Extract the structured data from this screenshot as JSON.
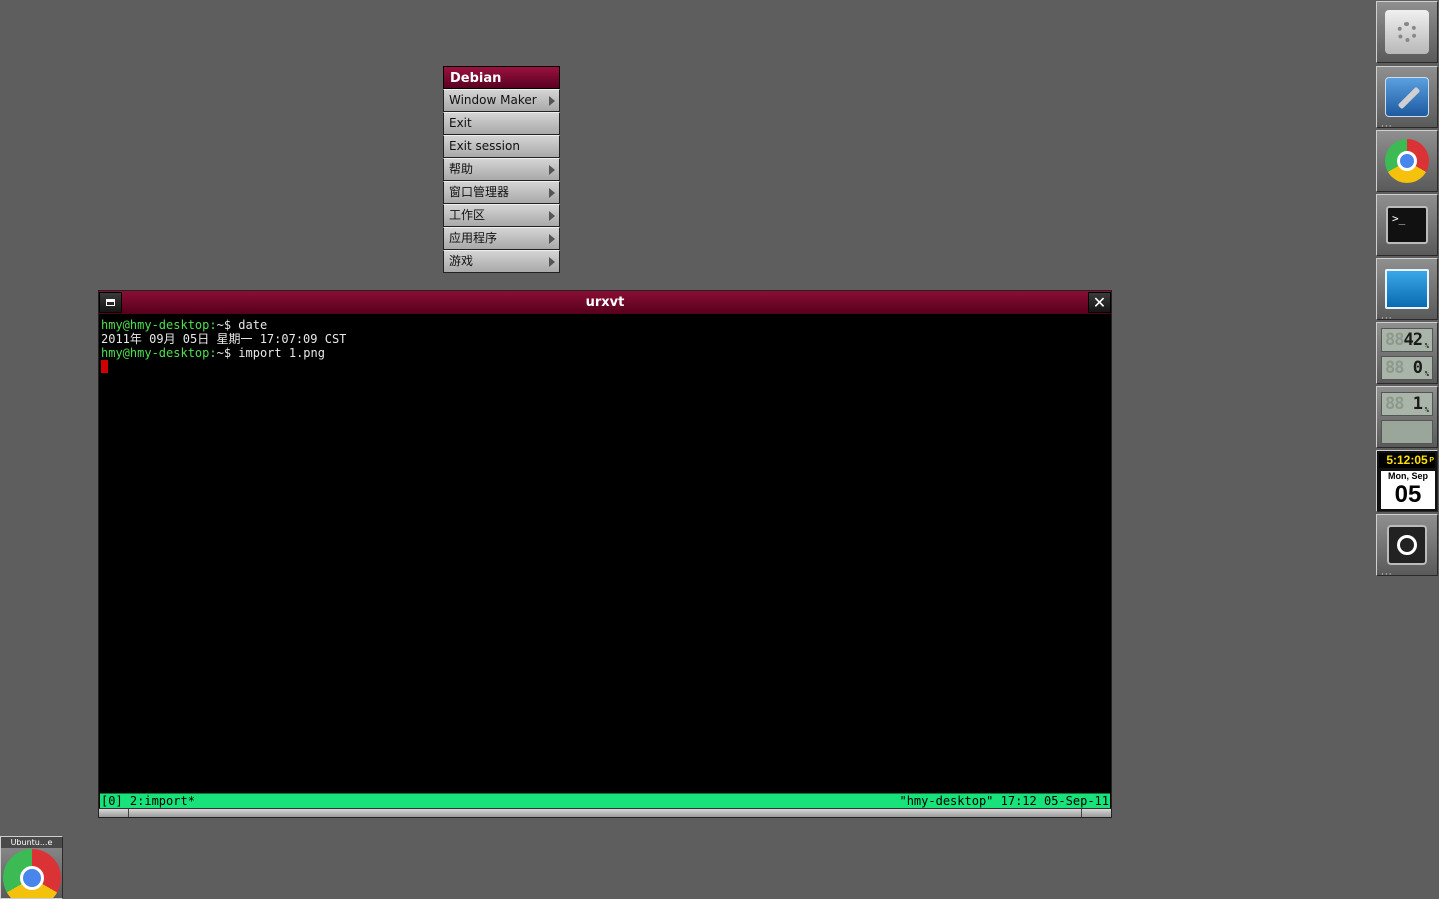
{
  "root_menu": {
    "title": "Debian",
    "items": [
      {
        "label": "Window Maker",
        "submenu": true
      },
      {
        "label": "Exit",
        "submenu": false
      },
      {
        "label": "Exit session",
        "submenu": false
      },
      {
        "label": "帮助",
        "submenu": true
      },
      {
        "label": "窗口管理器",
        "submenu": true
      },
      {
        "label": "工作区",
        "submenu": true
      },
      {
        "label": "应用程序",
        "submenu": true
      },
      {
        "label": "游戏",
        "submenu": true
      }
    ]
  },
  "terminal": {
    "title": "urxvt",
    "lines": [
      {
        "prompt": "hmy@hmy-desktop:",
        "text": "~$ date"
      },
      {
        "prompt": "",
        "text": "2011年 09月 05日 星期一 17:07:09 CST"
      },
      {
        "prompt": "hmy@hmy-desktop:",
        "text": "~$ import 1.png"
      }
    ],
    "status_left": "[0] 2:import*",
    "status_right": "\"hmy-desktop\" 17:12 05-Sep-11"
  },
  "dock": {
    "icons": [
      "gear-icon",
      "tools-icon",
      "chrome-icon",
      "terminal-icon",
      "system-monitor-icon",
      "memory-monitor",
      "cpu-monitor",
      "clock",
      "power-icon"
    ],
    "memory": {
      "mem_value": "42",
      "swap_value": "0",
      "unit": "%"
    },
    "cpu": {
      "value": "1",
      "unit": "%"
    },
    "clock": {
      "time": "5:12:05",
      "ampm": "P",
      "daymon": "Mon, Sep",
      "day": "05"
    }
  },
  "miniaturized": {
    "title": "Ubuntu...e"
  },
  "colors": {
    "accent": "#7a0a2e",
    "desktop": "#5e5e5e",
    "status_bar": "#18e27a",
    "prompt": "#4ee04e",
    "cursor": "#d00000"
  }
}
